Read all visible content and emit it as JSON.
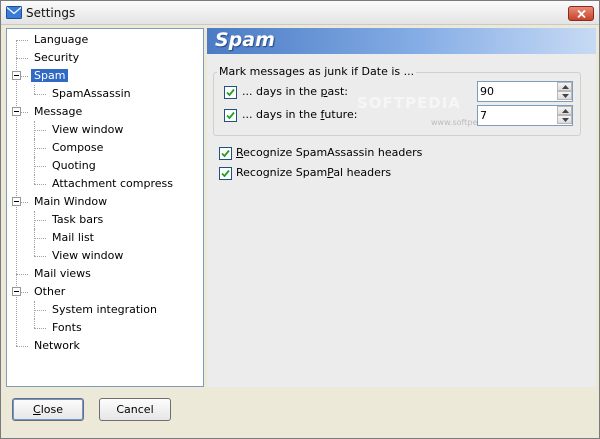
{
  "window": {
    "title": "Settings",
    "icon": "envelope-icon",
    "close_icon": "close-icon"
  },
  "watermark": {
    "text": "SOFTPEDIA",
    "url": "www.softpedia.com"
  },
  "tree": {
    "selected": "Spam",
    "items": [
      {
        "label": "Language",
        "level": 0,
        "expandable": false
      },
      {
        "label": "Security",
        "level": 0,
        "expandable": false
      },
      {
        "label": "Spam",
        "level": 0,
        "expandable": true
      },
      {
        "label": "SpamAssassin",
        "level": 1,
        "expandable": false
      },
      {
        "label": "Message",
        "level": 0,
        "expandable": true
      },
      {
        "label": "View window",
        "level": 1,
        "expandable": false
      },
      {
        "label": "Compose",
        "level": 1,
        "expandable": false
      },
      {
        "label": "Quoting",
        "level": 1,
        "expandable": false
      },
      {
        "label": "Attachment compress",
        "level": 1,
        "expandable": false
      },
      {
        "label": "Main Window",
        "level": 0,
        "expandable": true
      },
      {
        "label": "Task bars",
        "level": 1,
        "expandable": false
      },
      {
        "label": "Mail list",
        "level": 1,
        "expandable": false
      },
      {
        "label": "View window",
        "level": 1,
        "expandable": false
      },
      {
        "label": "Mail views",
        "level": 0,
        "expandable": false
      },
      {
        "label": "Other",
        "level": 0,
        "expandable": true
      },
      {
        "label": "System integration",
        "level": 1,
        "expandable": false
      },
      {
        "label": "Fonts",
        "level": 1,
        "expandable": false
      },
      {
        "label": "Network",
        "level": 0,
        "expandable": false
      }
    ]
  },
  "panel": {
    "title": "Spam",
    "group_label": "Mark messages as junk if Date is ...",
    "past": {
      "checked": true,
      "label_pre": "... days in the ",
      "label_ul": "p",
      "label_post": "ast:",
      "value": "90"
    },
    "future": {
      "checked": true,
      "label_pre": "... days in the ",
      "label_ul": "f",
      "label_post": "uture:",
      "value": "7"
    },
    "spamassassin": {
      "checked": true,
      "label_ul": "R",
      "label_post": "ecognize SpamAssassin headers"
    },
    "spampal": {
      "checked": true,
      "label_pre": "Recognize Spam",
      "label_ul": "P",
      "label_post": "al headers"
    }
  },
  "buttons": {
    "close": {
      "label_ul": "C",
      "label_post": "lose"
    },
    "cancel": {
      "label": "Cancel"
    }
  },
  "colors": {
    "header_start": "#4a7bc4",
    "header_end": "#c7daf4",
    "selection": "#316ac5",
    "close_button": "#c7432a"
  }
}
